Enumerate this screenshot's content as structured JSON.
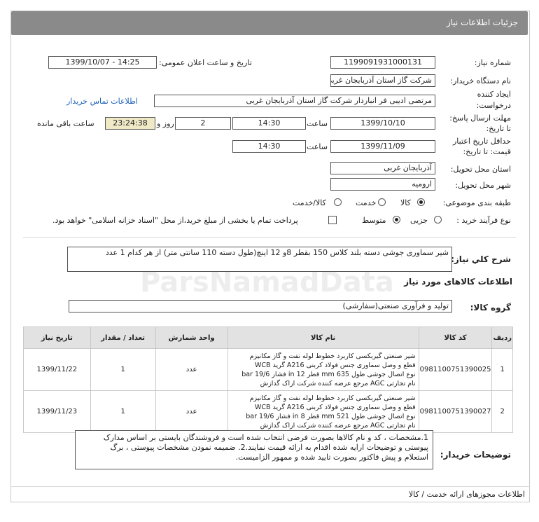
{
  "header": {
    "title": "جزئیات اطلاعات نیاز"
  },
  "fields": {
    "need_number_label": "شماره نیاز:",
    "need_number": "1199091931000131",
    "announce_label": "تاریخ و ساعت اعلان عمومی:",
    "announce_value": "1399/10/07 - 14:25",
    "buyer_label": "نام دستگاه خریدار:",
    "buyer_value": "شرکت گاز استان آذربایجان غربی",
    "creator_label_1": "ایجاد کننده",
    "creator_label_2": "درخواست:",
    "creator_value": "مرتضی ادیبی فر انباردار شرکت گاز استان آذربایجان غربی",
    "contact_link": "اطلاعات تماس خریدار",
    "deadline_label_1": "مهلت ارسال پاسخ:",
    "deadline_label_2": "تا تاریخ:",
    "deadline_date": "1399/10/10",
    "time_label": "ساعت",
    "deadline_time": "14:30",
    "days_value": "2",
    "days_label": "روز و",
    "remaining_time": "23:24:38",
    "remaining_label": "ساعت باقی مانده",
    "validity_label_1": "حداقل تاریخ اعتبار",
    "validity_label_2": "قیمت: تا تاریخ:",
    "validity_date": "1399/11/09",
    "validity_time_label": "ساعت",
    "validity_time": "14:30",
    "province_label": "استان محل تحویل:",
    "province_value": "آذربایجان غربی",
    "city_label": "شهر محل تحویل:",
    "city_value": "ارومیه",
    "category_label": "طبقه بندی موضوعی:",
    "category_goods": "کالا",
    "category_service": "خدمت",
    "category_both": "کالا/خدمت",
    "purchase_label": "نوع فرآیند خرید :",
    "purchase_partial": "جزیی",
    "purchase_medium": "متوسط",
    "purchase_note": "پرداخت تمام یا بخشی از مبلغ خرید،از محل \"اسناد خزانه اسلامی\" خواهد بود."
  },
  "summary": {
    "label": "شرح کلي نياز:",
    "value": "شیر سماوری جوشی دسته بلند کلاس 150 بقطر 8و 12 اینچ(طول دسته 110 سانتی متر) از هر کدام 1 عدد"
  },
  "goods_section": {
    "title": "اطلاعات کالاهای مورد نیاز",
    "group_label": "گروه کالا:",
    "group_value": "تولید و فرآوری صنعتی(سفارشی)"
  },
  "table": {
    "headers": [
      "ردیف",
      "کد کالا",
      "نام کالا",
      "واحد شمارش",
      "تعداد / مقدار",
      "تاریخ نیاز"
    ],
    "rows": [
      {
        "row": "1",
        "code": "0981100751390025",
        "name_lines": [
          "شیر صنعتی گیربکسی کاربرد خطوط لوله نفت و گاز مکانیزم",
          "قطع و وصل سماوری جنس فولاد کربنی A216 گرید WCB",
          "نوع اتصال جوشی طول 635 mm قطر 12 in فشار 19/6 bar",
          "نام تجارتی AGC مرجع عرضه کننده شرکت اراک گدازش"
        ],
        "unit": "عدد",
        "qty": "1",
        "date": "1399/11/22"
      },
      {
        "row": "2",
        "code": "0981100751390027",
        "name_lines": [
          "شیر صنعتی گیربکسی کاربرد خطوط لوله نفت و گاز مکانیزم",
          "قطع و وصل سماوری جنس فولاد کربنی A216 گرید WCB",
          "نوع اتصال جوشی طول 521 mm قطر 8 in فشار 19/6 bar",
          "نام تجارتی AGC مرجع عرضه کننده شرکت اراک گدازش"
        ],
        "unit": "عدد",
        "qty": "1",
        "date": "1399/11/23"
      }
    ]
  },
  "notes": {
    "label": "توضیحات خریدار:",
    "lines": [
      "1.مشخصات ، کد و نام کالاها بصورت فرضی انتخاب شده است و فروشندگان بایستی بر اساس مدارک",
      "پیوستی و توضیحات ارایه شده اقدام به ارائه قیمت نمایند.2. ضمیمه نمودن مشخصات پیوستی ، برگ",
      "استعلام و پیش فاکتور بصورت تایید شده و ممهور الزامیست."
    ]
  },
  "footer": {
    "license": "اطلاعات مجوزهای ارائه خدمت / کالا"
  },
  "watermark": "ParsNamadData"
}
